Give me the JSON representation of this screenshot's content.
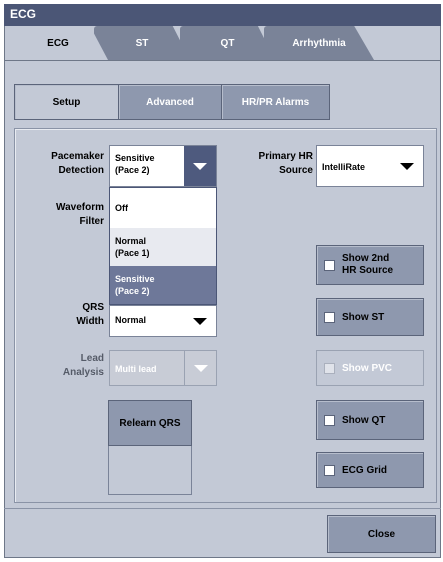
{
  "window": {
    "title": "ECG"
  },
  "tabs": [
    {
      "label": "ECG",
      "active": true
    },
    {
      "label": "ST",
      "active": false
    },
    {
      "label": "QT",
      "active": false
    },
    {
      "label": "Arrhythmia",
      "active": false
    }
  ],
  "subtabs": [
    {
      "label": "Setup",
      "active": false
    },
    {
      "label": "Advanced",
      "active": true
    },
    {
      "label": "HR/PR Alarms",
      "active": false
    }
  ],
  "pacemaker": {
    "label_line1": "Pacemaker",
    "label_line2": "Detection",
    "value_line1": "Sensitive",
    "value_line2": "(Pace 2)",
    "options": [
      {
        "line1": "Off",
        "line2": ""
      },
      {
        "line1": "Normal",
        "line2": "(Pace 1)"
      },
      {
        "line1": "Sensitive",
        "line2": "(Pace 2)"
      }
    ]
  },
  "waveform_filter": {
    "label_line1": "Waveform",
    "label_line2": "Filter"
  },
  "qrs_width": {
    "label_line1": "QRS",
    "label_line2": "Width",
    "value": "Normal"
  },
  "lead_analysis": {
    "label_line1": "Lead",
    "label_line2": "Analysis",
    "value": "Multi lead",
    "enabled": false
  },
  "relearn_qrs": {
    "label": "Relearn QRS"
  },
  "primary_hr": {
    "label_line1": "Primary HR",
    "label_line2": "Source",
    "value": "IntelliRate"
  },
  "checkboxes": {
    "show_2nd_hr": {
      "line1": "Show 2nd",
      "line2": "HR Source",
      "checked": false
    },
    "show_st": {
      "label": "Show ST",
      "checked": false
    },
    "show_pvc": {
      "label": "Show PVC",
      "checked": false,
      "enabled": false
    },
    "show_qt": {
      "label": "Show QT",
      "checked": false
    },
    "ecg_grid": {
      "label": "ECG Grid",
      "checked": false
    }
  },
  "close": {
    "label": "Close"
  }
}
